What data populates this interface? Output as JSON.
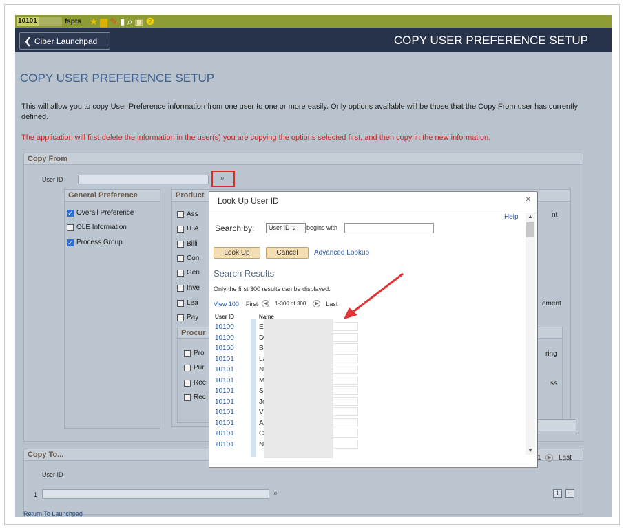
{
  "topbar": {
    "user_id": "10101",
    "env": "fspts"
  },
  "header": {
    "back_label": "Ciber Launchpad",
    "title": "COPY USER PREFERENCE SETUP"
  },
  "page": {
    "title": "COPY USER PREFERENCE SETUP",
    "description": "This will allow you to copy User Preference information from one user to one or more easily. Only options available will be those that the Copy From user has currently defined.",
    "warning": "The application will first delete the information in the user(s) you are copying the options selected first, and then copy in the new information."
  },
  "copy_from": {
    "title": "Copy From",
    "user_id_label": "User ID",
    "general": {
      "title": "General Preference",
      "items": [
        {
          "label": "Overall Preference",
          "checked": true
        },
        {
          "label": "OLE Information",
          "checked": false
        },
        {
          "label": "Process Group",
          "checked": true
        }
      ]
    },
    "product": {
      "title": "Product",
      "fragments": [
        "Ass",
        "IT A",
        "Billi",
        "Con",
        "Gen",
        "Inve",
        "Lea",
        "Pay"
      ]
    },
    "procure": {
      "title": "Procur",
      "fragments": [
        "Pro",
        "Pur",
        "Rec",
        "Rec"
      ]
    },
    "right_fragments": [
      "nt",
      "ement",
      "ring",
      "ss"
    ]
  },
  "copy_to": {
    "title": "Copy To...",
    "user_id_header": "User ID",
    "row_num": "1",
    "last_label": "Last",
    "page_num": "1"
  },
  "return_link": "Return To Launchpad",
  "dialog": {
    "title": "Look Up User ID",
    "help": "Help",
    "search_by_label": "Search by:",
    "search_by_value": "User ID",
    "begins_with": "begins with",
    "lookup_btn": "Look Up",
    "cancel_btn": "Cancel",
    "advanced_link": "Advanced Lookup",
    "results_title": "Search Results",
    "results_note": "Only the first 300 results can be displayed.",
    "view_label": "View 100",
    "first_label": "First",
    "range": "1-300 of 300",
    "last_label": "Last",
    "col_id": "User ID",
    "col_name": "Name",
    "rows": [
      {
        "id": "10100",
        "name": "El"
      },
      {
        "id": "10100",
        "name": "Da"
      },
      {
        "id": "10100",
        "name": "Br"
      },
      {
        "id": "10101",
        "name": "La"
      },
      {
        "id": "10101",
        "name": "Na"
      },
      {
        "id": "10101",
        "name": "M"
      },
      {
        "id": "10101",
        "name": "Se"
      },
      {
        "id": "10101",
        "name": "Jo"
      },
      {
        "id": "10101",
        "name": "Vi"
      },
      {
        "id": "10101",
        "name": "Ar"
      },
      {
        "id": "10101",
        "name": "Co"
      },
      {
        "id": "10101",
        "name": "Ni"
      }
    ]
  }
}
